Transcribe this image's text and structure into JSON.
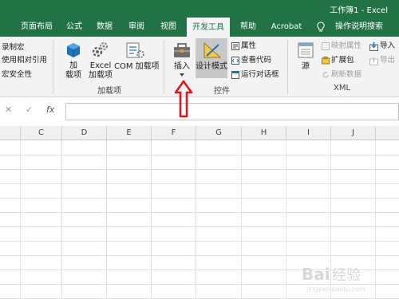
{
  "title_bar": {
    "title": "工作簿1 - Excel"
  },
  "tabs": [
    {
      "label": "页面布局",
      "active": false
    },
    {
      "label": "公式",
      "active": false
    },
    {
      "label": "数据",
      "active": false
    },
    {
      "label": "审阅",
      "active": false
    },
    {
      "label": "视图",
      "active": false
    },
    {
      "label": "开发工具",
      "active": true
    },
    {
      "label": "帮助",
      "active": false
    },
    {
      "label": "Acrobat",
      "active": false
    },
    {
      "label": "操作说明搜索",
      "active": false
    }
  ],
  "ribbon": {
    "code": {
      "record_macro": "录制宏",
      "relative_ref": "使用相对引用",
      "macro_security": "宏安全性"
    },
    "addins": {
      "addins_line1": "加",
      "addins_line2": "载项",
      "excel_addins_line1": "Excel",
      "excel_addins_line2": "加载项",
      "com_addins": "COM 加载项",
      "group_label": "加载项"
    },
    "controls": {
      "insert": "插入",
      "design_mode": "设计模式",
      "properties": "属性",
      "view_code": "查看代码",
      "run_dialog": "运行对话框",
      "group_label": "控件"
    },
    "xml": {
      "source": "源",
      "map_properties": "映射属性",
      "expansion_packs": "扩展包",
      "refresh_data": "刷新数据",
      "import": "导入",
      "export": "导出",
      "group_label": "XML"
    }
  },
  "formula_bar": {
    "cancel_glyph": "✕",
    "enter_glyph": "✓",
    "fx_glyph": "fx",
    "value": ""
  },
  "columns": [
    "C",
    "D",
    "E",
    "F",
    "G",
    "H",
    "I",
    "J"
  ],
  "annotation": {
    "color": "#e8101a"
  },
  "watermark": {
    "text": "Bai经验",
    "subtext": "jingyan.baidu.com"
  },
  "colors": {
    "excel_green": "#217346",
    "ribbon_bg": "#f3f3f3"
  }
}
